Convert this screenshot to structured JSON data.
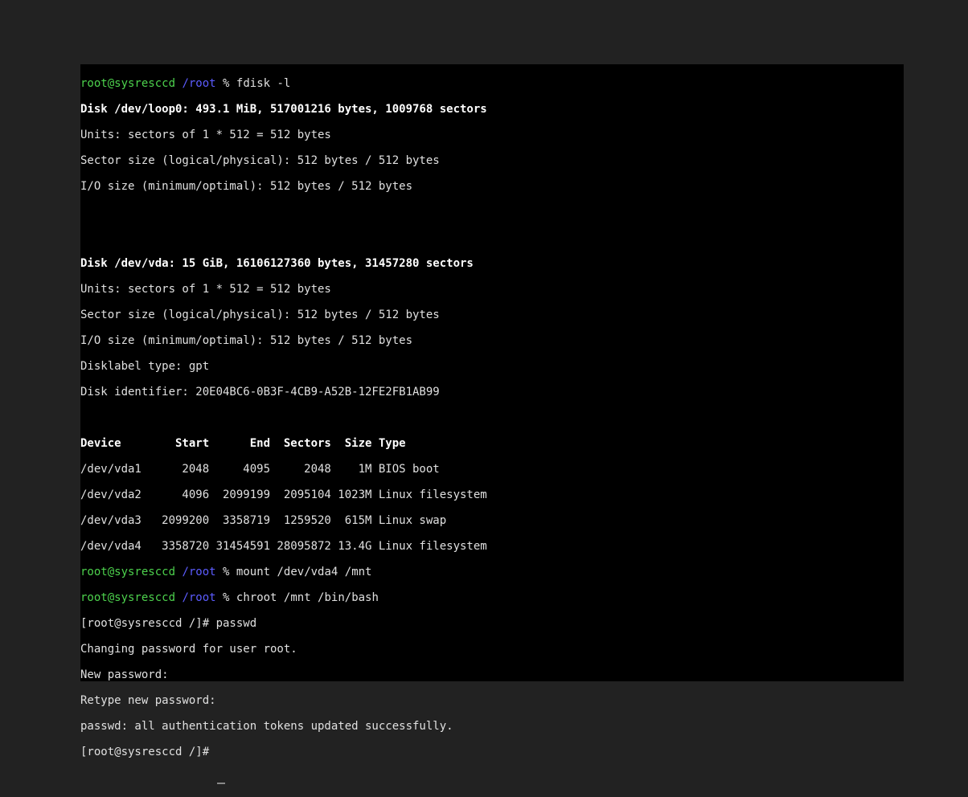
{
  "prompt1": {
    "userhost": "root@sysresccd",
    "cwd": "/root",
    "sep": " % ",
    "cmd": "fdisk -l"
  },
  "loop0": {
    "header": "Disk /dev/loop0: 493.1 MiB, 517001216 bytes, 1009768 sectors",
    "units": "Units: sectors of 1 * 512 = 512 bytes",
    "sector": "Sector size (logical/physical): 512 bytes / 512 bytes",
    "io": "I/O size (minimum/optimal): 512 bytes / 512 bytes"
  },
  "vda": {
    "header": "Disk /dev/vda: 15 GiB, 16106127360 bytes, 31457280 sectors",
    "units": "Units: sectors of 1 * 512 = 512 bytes",
    "sector": "Sector size (logical/physical): 512 bytes / 512 bytes",
    "io": "I/O size (minimum/optimal): 512 bytes / 512 bytes",
    "label": "Disklabel type: gpt",
    "ident": "Disk identifier: 20E04BC6-0B3F-4CB9-A52B-12FE2FB1AB99"
  },
  "tableHeader": "Device        Start      End  Sectors  Size Type",
  "rows": {
    "r1": "/dev/vda1      2048     4095     2048    1M BIOS boot",
    "r2": "/dev/vda2      4096  2099199  2095104 1023M Linux filesystem",
    "r3": "/dev/vda3   2099200  3358719  1259520  615M Linux swap",
    "r4": "/dev/vda4   3358720 31454591 28095872 13.4G Linux filesystem"
  },
  "prompt2": {
    "userhost": "root@sysresccd",
    "cwd": "/root",
    "sep": " % ",
    "cmd": "mount /dev/vda4 /mnt"
  },
  "prompt3": {
    "userhost": "root@sysresccd",
    "cwd": "/root",
    "sep": " % ",
    "cmd": "chroot /mnt /bin/bash"
  },
  "chroot": {
    "p1": "[root@sysresccd /]# passwd",
    "l1": "Changing password for user root.",
    "l2": "New password:",
    "l3": "Retype new password:",
    "l4": "passwd: all authentication tokens updated successfully.",
    "p2": "[root@sysresccd /]# "
  }
}
